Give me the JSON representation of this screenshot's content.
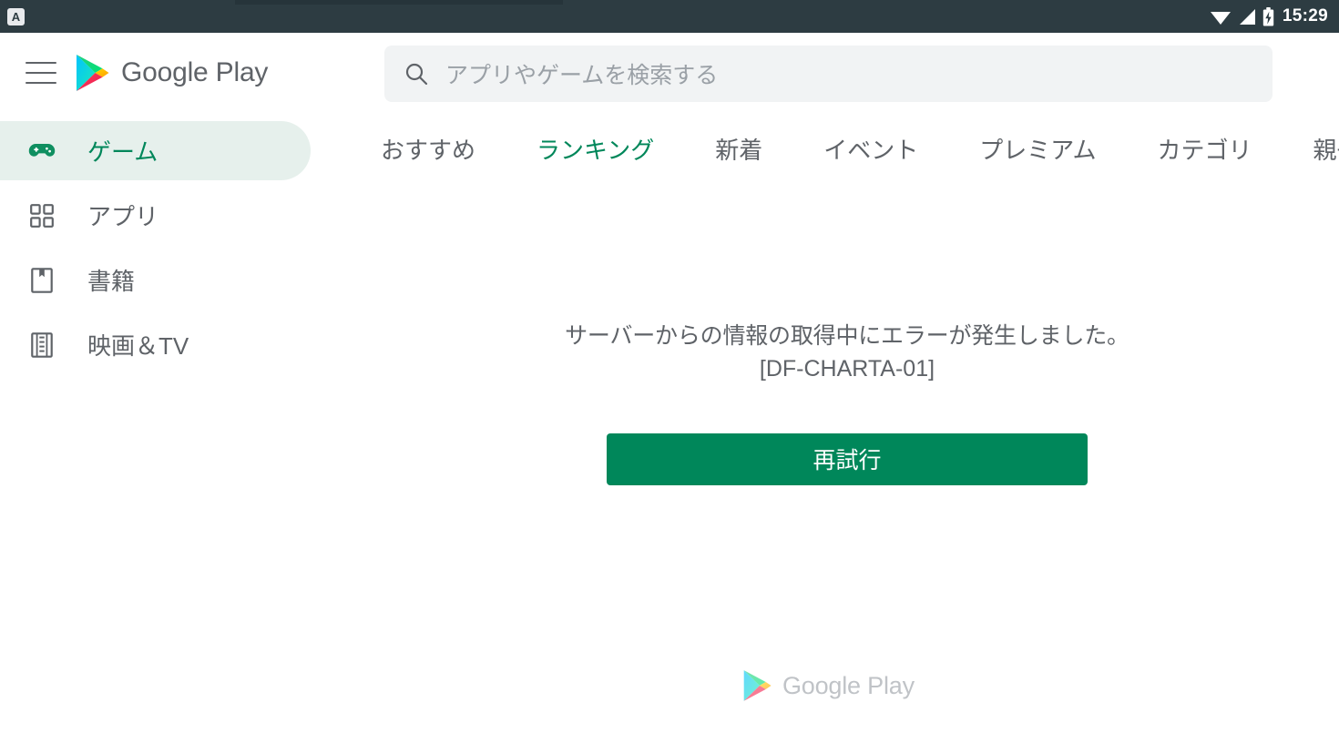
{
  "status_bar": {
    "notification_icon": "app-notification-icon",
    "notification_letter": "A",
    "wifi_icon": "wifi-icon",
    "signal_icon": "cellular-signal-icon",
    "battery_icon": "battery-charging-icon",
    "clock": "15:29"
  },
  "header": {
    "menu_icon": "hamburger-menu-icon",
    "brand_icon": "google-play-logo-icon",
    "brand_text": "Google Play"
  },
  "search": {
    "icon": "search-icon",
    "placeholder": "アプリやゲームを検索する",
    "value": ""
  },
  "sidebar": {
    "items": [
      {
        "label": "ゲーム",
        "icon": "gamepad-icon",
        "active": true
      },
      {
        "label": "アプリ",
        "icon": "apps-grid-icon",
        "active": false
      },
      {
        "label": "書籍",
        "icon": "book-icon",
        "active": false
      },
      {
        "label": "映画＆TV",
        "icon": "film-strip-icon",
        "active": false
      }
    ]
  },
  "tabs": [
    {
      "label": "おすすめ",
      "active": false
    },
    {
      "label": "ランキング",
      "active": true
    },
    {
      "label": "新着",
      "active": false
    },
    {
      "label": "イベント",
      "active": false
    },
    {
      "label": "プレミアム",
      "active": false
    },
    {
      "label": "カテゴリ",
      "active": false
    },
    {
      "label": "親子",
      "active": false
    }
  ],
  "content": {
    "error_message": "サーバーからの情報の取得中にエラーが発生しました。",
    "error_code": "[DF-CHARTA-01]",
    "retry_label": "再試行"
  },
  "footer": {
    "logo_icon": "google-play-logo-icon",
    "logo_text": "Google Play"
  },
  "colors": {
    "accent_green": "#00875a",
    "pill_green": "#e6f0ec",
    "status_bar": "#2d3c42",
    "text_gray": "#5f6368",
    "placeholder_gray": "#9aa0a6",
    "search_bg": "#f1f3f4"
  }
}
